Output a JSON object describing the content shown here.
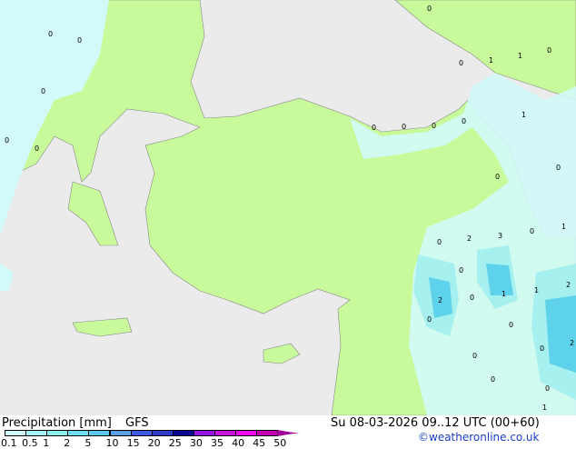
{
  "title": "Precipitation [mm]",
  "model": "GFS",
  "valid_time": "Su 08-03-2026 09..12 UTC (00+60)",
  "credit": "©weatheronline.co.uk",
  "scale": {
    "ticks": [
      "0.1",
      "0.5",
      "1",
      "2",
      "5",
      "10",
      "15",
      "20",
      "25",
      "30",
      "35",
      "40",
      "45",
      "50"
    ],
    "colors": [
      "#d2fafa",
      "#a6f5f5",
      "#8ceded",
      "#6ee0ef",
      "#5cc8ec",
      "#5aa0e8",
      "#3c5ae6",
      "#2d3cc8",
      "#0a0a96",
      "#9614e6",
      "#c814dc",
      "#f00af0",
      "#c800b4",
      "#a00096"
    ]
  },
  "colors": {
    "sea": "#ebebeb",
    "land": "#c8fa9b",
    "precip_light": "#d2fafa",
    "precip_mid": "#a6f0f0",
    "precip_heavy": "#5ed2ea"
  },
  "map_labels": [
    "0",
    "0",
    "0",
    "0",
    "0",
    "0",
    "0",
    "1",
    "1",
    "0",
    "0",
    "0",
    "0",
    "0",
    "1",
    "0",
    "1",
    "0",
    "2",
    "3",
    "0",
    "2",
    "0",
    "1",
    "1",
    "2",
    "2",
    "0",
    "0",
    "0",
    "0",
    "0",
    "0",
    "0",
    "0",
    "1"
  ]
}
